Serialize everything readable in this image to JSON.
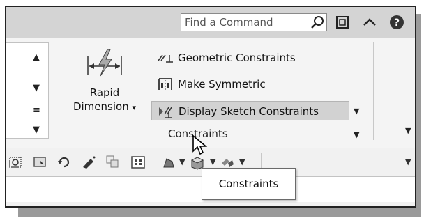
{
  "search": {
    "placeholder": "Find a Command"
  },
  "ribbon": {
    "rapid_dimension": {
      "line1": "Rapid",
      "line2": "Dimension",
      "arrow": "▾"
    },
    "commands": [
      {
        "label": "Geometric Constraints",
        "icon": "geometric-constraints-icon"
      },
      {
        "label": "Make Symmetric",
        "icon": "make-symmetric-icon"
      },
      {
        "label": "Display Sketch Constraints",
        "icon": "display-sketch-constraints-icon",
        "active": true
      }
    ],
    "panel_label": "Constraints"
  },
  "toolbar": {
    "icons": [
      "zoom-area-icon",
      "view-icon",
      "rotate-icon",
      "paint-icon",
      "layers-icon",
      "grid-icon",
      "shape-icon",
      "box-icon",
      "material-icon"
    ]
  },
  "tooltip": {
    "text": "Constraints"
  },
  "colors": {
    "ribbon": "#f4f4f4",
    "active": "#d2d2d2",
    "title": "#d4d4d4"
  }
}
